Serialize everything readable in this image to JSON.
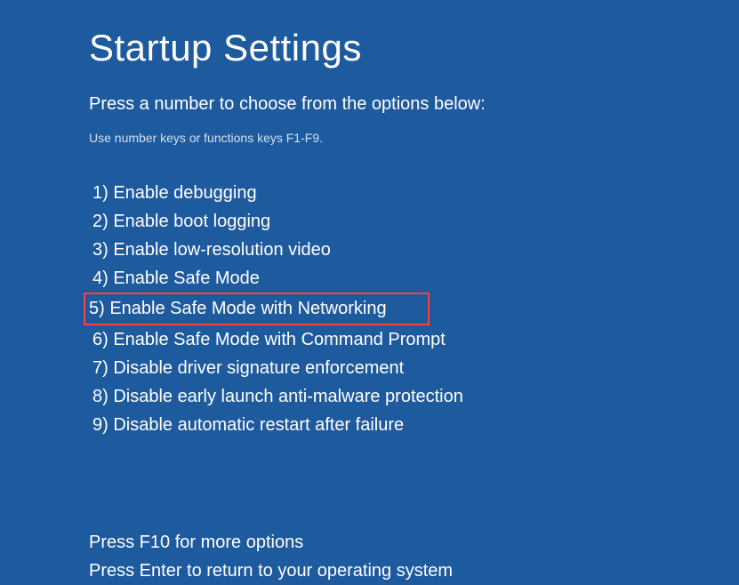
{
  "title": "Startup Settings",
  "subtitle": "Press a number to choose from the options below:",
  "hint": "Use number keys or functions keys F1-F9.",
  "options": [
    "1) Enable debugging",
    "2) Enable boot logging",
    "3) Enable low-resolution video",
    "4) Enable Safe Mode",
    "5) Enable Safe Mode with Networking",
    "6) Enable Safe Mode with Command Prompt",
    "7) Disable driver signature enforcement",
    "8) Disable early launch anti-malware protection",
    "9) Disable automatic restart after failure"
  ],
  "highlighted_index": 4,
  "footer": [
    "Press F10 for more options",
    "Press Enter to return to your operating system"
  ]
}
